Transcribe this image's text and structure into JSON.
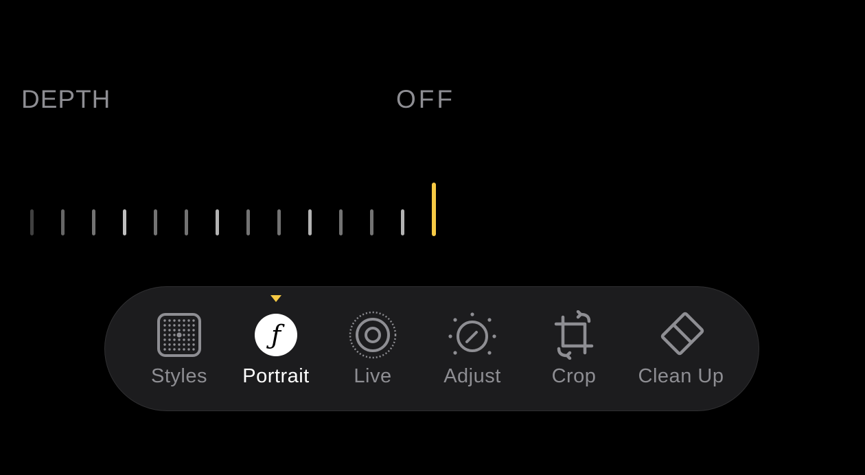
{
  "adjustment": {
    "name": "DEPTH",
    "value": "OFF"
  },
  "slider": {
    "tick_count": 14,
    "current_index": 13,
    "tick_opacities": [
      0.25,
      0.4,
      0.45,
      0.75,
      0.45,
      0.45,
      0.7,
      0.45,
      0.45,
      0.7,
      0.45,
      0.45,
      0.7,
      1.0
    ]
  },
  "toolbar": {
    "active": "portrait",
    "tools": [
      {
        "id": "styles",
        "label": "Styles",
        "icon": "styles-grid-icon"
      },
      {
        "id": "portrait",
        "label": "Portrait",
        "icon": "aperture-f-icon"
      },
      {
        "id": "live",
        "label": "Live",
        "icon": "live-photo-icon"
      },
      {
        "id": "adjust",
        "label": "Adjust",
        "icon": "adjust-dial-icon"
      },
      {
        "id": "crop",
        "label": "Crop",
        "icon": "crop-rotate-icon"
      },
      {
        "id": "cleanup",
        "label": "Clean Up",
        "icon": "eraser-icon"
      }
    ]
  },
  "colors": {
    "background": "#000000",
    "accent": "#f6c944",
    "inactive_text": "#8e8e93",
    "active_text": "#ffffff",
    "toolbar_bg": "#1c1c1e"
  }
}
